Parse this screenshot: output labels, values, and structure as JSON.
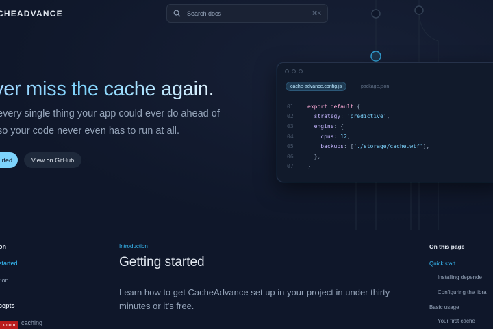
{
  "header": {
    "logo": "CHEADVANCE",
    "search_placeholder": "Search docs",
    "search_shortcut": "⌘K"
  },
  "hero": {
    "headline": "ver miss the cache again.",
    "subtitle_line1": "every single thing your app could ever do ahead of",
    "subtitle_line2": "so your code never even has to run at all.",
    "primary_button": "rted",
    "secondary_button": "View on GitHub"
  },
  "code_card": {
    "tabs": [
      "cache-advance.config.js",
      "package.json"
    ],
    "lines": [
      {
        "n": "01",
        "parts": [
          [
            "kw",
            "export default "
          ],
          [
            "pn",
            "{"
          ]
        ]
      },
      {
        "n": "02",
        "parts": [
          [
            "plain",
            "  "
          ],
          [
            "prop",
            "strategy"
          ],
          [
            "pn",
            ": "
          ],
          [
            "str",
            "'predictive'"
          ],
          [
            "pn",
            ","
          ]
        ]
      },
      {
        "n": "03",
        "parts": [
          [
            "plain",
            "  "
          ],
          [
            "prop",
            "engine"
          ],
          [
            "pn",
            ": {"
          ]
        ]
      },
      {
        "n": "04",
        "parts": [
          [
            "plain",
            "    "
          ],
          [
            "prop",
            "cpus"
          ],
          [
            "pn",
            ": "
          ],
          [
            "num",
            "12"
          ],
          [
            "pn",
            ","
          ]
        ]
      },
      {
        "n": "05",
        "parts": [
          [
            "plain",
            "    "
          ],
          [
            "prop",
            "backups"
          ],
          [
            "pn",
            ": ["
          ],
          [
            "str",
            "'./storage/cache.wtf'"
          ],
          [
            "pn",
            "],"
          ]
        ]
      },
      {
        "n": "06",
        "parts": [
          [
            "pn",
            "  },"
          ]
        ]
      },
      {
        "n": "07",
        "parts": [
          [
            "pn",
            "}"
          ]
        ]
      }
    ]
  },
  "sidebar": {
    "items": [
      {
        "label": "on",
        "style": "heading"
      },
      {
        "label": "started",
        "style": "active"
      },
      {
        "label": "tion",
        "style": "normal"
      },
      {
        "label": "cepts",
        "style": "heading"
      },
      {
        "label": "caching",
        "style": "normal"
      }
    ]
  },
  "content": {
    "breadcrumb": "Introduction",
    "title": "Getting started",
    "body": "Learn how to get CacheAdvance set up in your project in under thirty minutes or it's free."
  },
  "toc": {
    "heading": "On this page",
    "items": [
      {
        "label": "Quick start",
        "style": "active"
      },
      {
        "label": "Installing depende",
        "style": "normal"
      },
      {
        "label": "Configuring the libra",
        "style": "normal"
      },
      {
        "label": "Basic usage",
        "style": "normal"
      },
      {
        "label": "Your first cache",
        "style": "normal"
      }
    ]
  },
  "badge": {
    "label": "k.com"
  },
  "colors": {
    "accent": "#38bdf8",
    "background": "#0f172a",
    "primary_button": "#7dd3fc"
  }
}
